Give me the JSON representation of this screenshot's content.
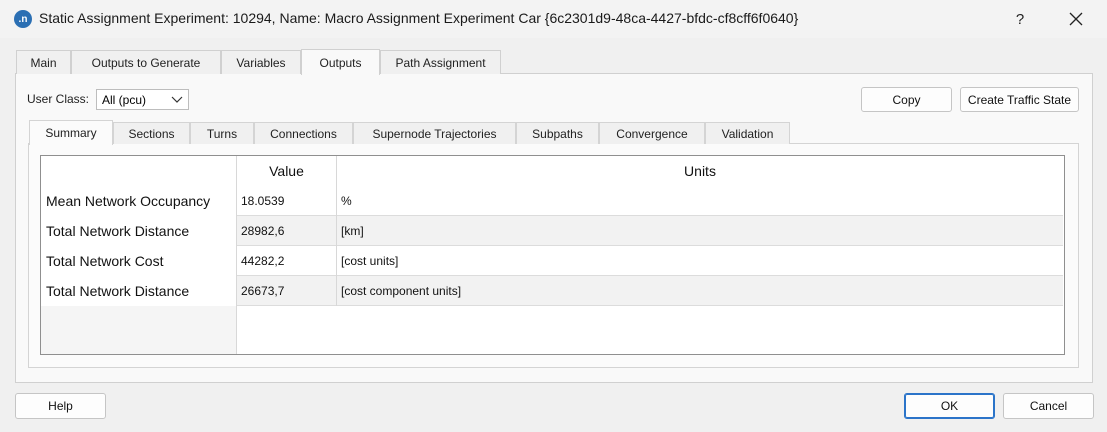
{
  "window": {
    "title": "Static Assignment Experiment: 10294, Name: Macro Assignment Experiment Car  {6c2301d9-48ca-4427-bfdc-cf8cff6f0640}",
    "app_icon_text": ".n",
    "help_label": "?"
  },
  "main_tabs": [
    "Main",
    "Outputs to Generate",
    "Variables",
    "Outputs",
    "Path Assignment"
  ],
  "active_main_tab": "Outputs",
  "user_class": {
    "label": "User Class:",
    "value": "All (pcu)"
  },
  "buttons": {
    "copy": "Copy",
    "create_traffic_state": "Create Traffic State",
    "help": "Help",
    "ok": "OK",
    "cancel": "Cancel"
  },
  "sub_tabs": [
    "Summary",
    "Sections",
    "Turns",
    "Connections",
    "Supernode Trajectories",
    "Subpaths",
    "Convergence",
    "Validation"
  ],
  "active_sub_tab": "Summary",
  "table": {
    "headers": {
      "value": "Value",
      "units": "Units"
    },
    "rows": [
      {
        "label": "Mean Network Occupancy",
        "value": "18.0539",
        "units": "%"
      },
      {
        "label": "Total Network Distance",
        "value": "28982,6",
        "units": "[km]"
      },
      {
        "label": "Total Network Cost",
        "value": "44282,2",
        "units": "[cost units]"
      },
      {
        "label": "Total Network Distance",
        "value": "26673,7",
        "units": "[cost component units]"
      }
    ]
  }
}
